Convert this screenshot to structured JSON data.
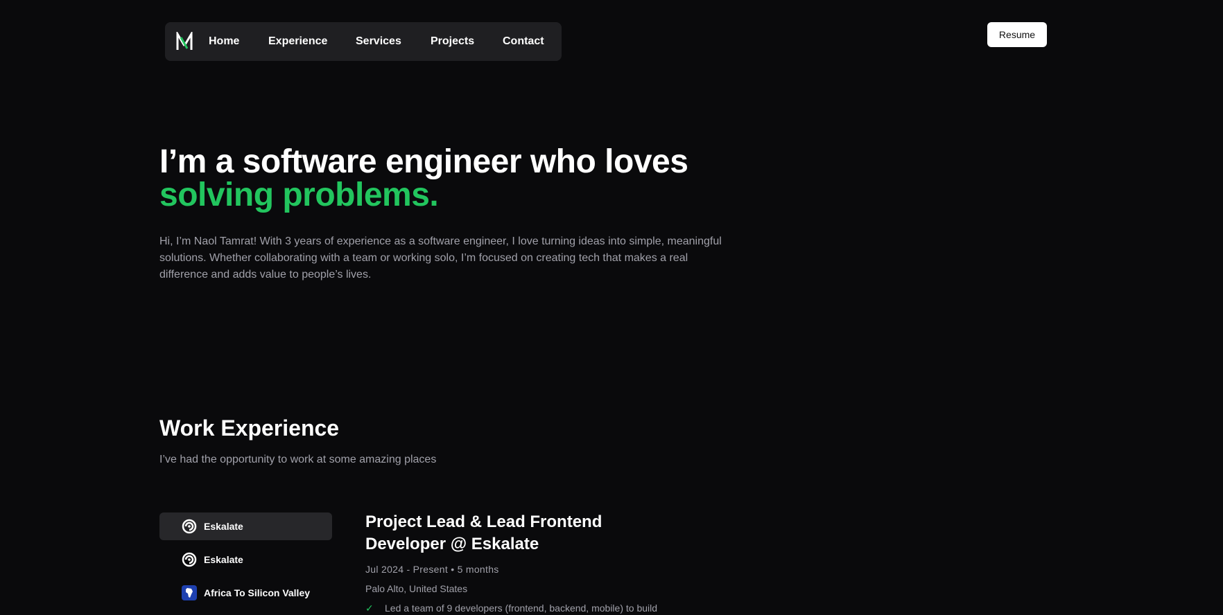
{
  "nav": {
    "logo_icon": "logo-n-icon",
    "items": [
      {
        "label": "Home"
      },
      {
        "label": "Experience"
      },
      {
        "label": "Services"
      },
      {
        "label": "Projects"
      },
      {
        "label": "Contact"
      }
    ],
    "resume_label": "Resume"
  },
  "hero": {
    "title_line1": "I’m a software engineer who loves",
    "title_line2": "solving problems.",
    "accent_color": "#22c55e",
    "description": "Hi, I’m Naol Tamrat! With 3 years of experience as a software engineer, I love turning ideas into simple, meaningful solutions. Whether collaborating with a team or working solo, I’m focused on creating tech that makes a real difference and adds value to people’s lives."
  },
  "experience": {
    "title": "Work Experience",
    "subtitle": "I’ve had the opportunity to work at some amazing places",
    "companies": [
      {
        "name": "Eskalate",
        "icon": "eskalate-icon",
        "active": true
      },
      {
        "name": "Eskalate",
        "icon": "eskalate-icon",
        "active": false
      },
      {
        "name": "Africa To Silicon Valley",
        "icon": "africa-icon",
        "active": false
      }
    ],
    "job": {
      "title": "Project Lead & Lead Frontend Developer @ Eskalate",
      "meta": "Jul 2024 - Present • 5 months",
      "location": "Palo Alto, United States",
      "bullet": "Led a team of 9 developers (frontend, backend, mobile) to build"
    }
  }
}
